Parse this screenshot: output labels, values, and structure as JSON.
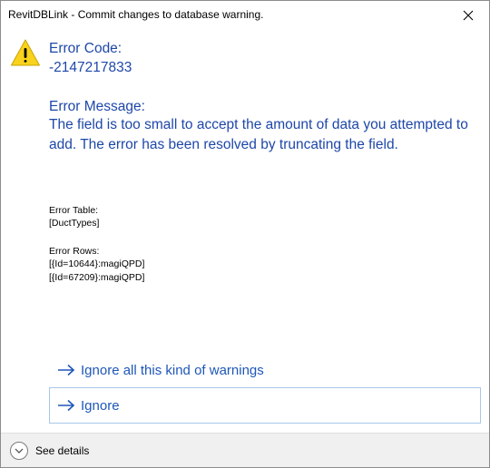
{
  "window": {
    "title": "RevitDBLink - Commit changes to database warning."
  },
  "icons": {
    "close": "close-icon",
    "warning": "warning-icon",
    "arrow": "arrow-right-icon",
    "chevron": "chevron-down-icon"
  },
  "colors": {
    "heading_blue": "#1e47a8",
    "link_blue": "#1e57b8",
    "warning_yellow": "#f8d21c"
  },
  "error": {
    "code_label": "Error Code:",
    "code_value": "-2147217833",
    "message_label": "Error Message:",
    "message_text": "The field is too small to accept the amount of data you attempted to add. The error has been resolved by truncating the field."
  },
  "details": {
    "table_label": "Error Table:",
    "table_value": "[DuctTypes]",
    "rows_label": "Error Rows:",
    "rows": [
      "[{Id=10644}:magiQPD]",
      "[{Id=67209}:magiQPD]"
    ]
  },
  "commands": {
    "ignore_all": "Ignore all this kind of warnings",
    "ignore": "Ignore"
  },
  "footer": {
    "see_details": "See details"
  }
}
